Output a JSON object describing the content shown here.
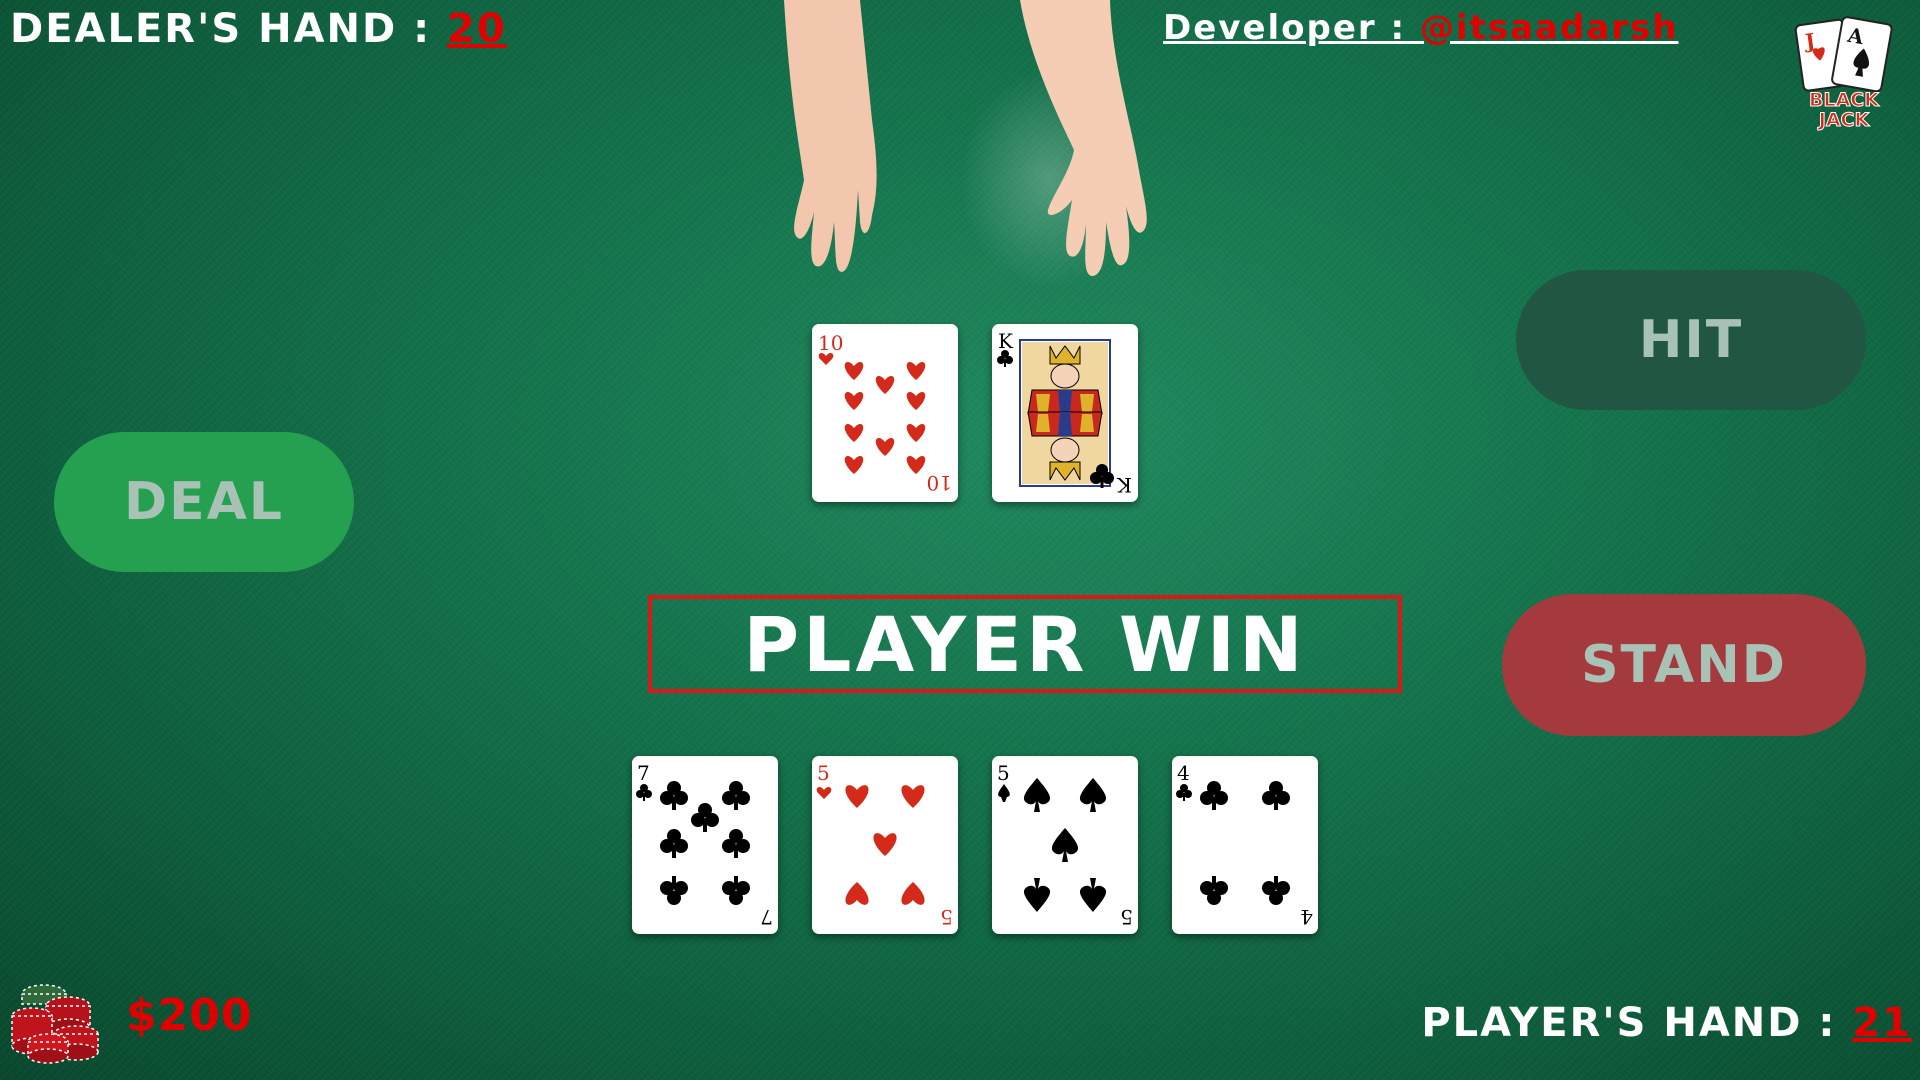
{
  "hud": {
    "dealer_label": "DEALER'S HAND : ",
    "dealer_value": "20",
    "player_label": "PLAYER'S HAND : ",
    "player_value": "21",
    "developer_label": "Developer : ",
    "developer_handle": "@itsaadarsh",
    "money": "$200"
  },
  "logo": {
    "line1": "BLACK",
    "line2": "JACK",
    "card_j": "J",
    "card_a": "A"
  },
  "buttons": {
    "deal": "DEAL",
    "hit": "HIT",
    "stand": "STAND"
  },
  "result": "PLAYER WIN",
  "dealer_cards": [
    {
      "rank": "10",
      "suit": "hearts",
      "color": "#d42a1a"
    },
    {
      "rank": "K",
      "suit": "clubs",
      "color": "#000000"
    }
  ],
  "player_cards": [
    {
      "rank": "7",
      "suit": "clubs",
      "color": "#000000"
    },
    {
      "rank": "5",
      "suit": "hearts",
      "color": "#d42a1a"
    },
    {
      "rank": "5",
      "suit": "spades",
      "color": "#000000"
    },
    {
      "rank": "4",
      "suit": "clubs",
      "color": "#000000"
    }
  ],
  "colors": {
    "accent_red": "#e00000",
    "deal_button": "#25a050",
    "hit_button": "#215642",
    "stand_button": "#a53a3e",
    "result_border": "#d61a1a"
  }
}
